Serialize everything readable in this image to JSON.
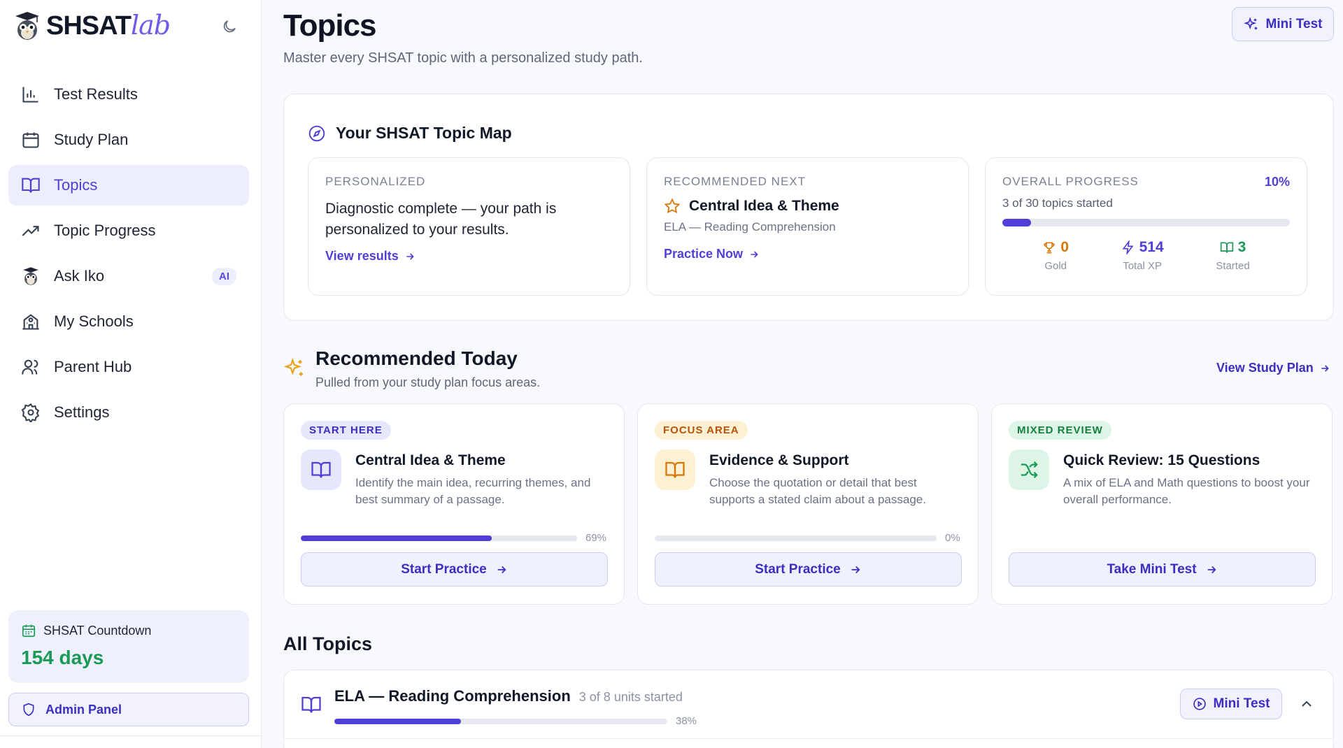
{
  "app": {
    "logo_main": "SHSAT",
    "logo_accent": "lab"
  },
  "sidebar": {
    "items": [
      {
        "label": "Test Results",
        "icon": "bar-chart-icon"
      },
      {
        "label": "Study Plan",
        "icon": "calendar-icon"
      },
      {
        "label": "Topics",
        "icon": "book-open-icon",
        "active": true
      },
      {
        "label": "Topic Progress",
        "icon": "trending-up-icon"
      },
      {
        "label": "Ask Iko",
        "icon": "owl-icon",
        "badge": "AI"
      },
      {
        "label": "My Schools",
        "icon": "school-icon"
      },
      {
        "label": "Parent Hub",
        "icon": "users-icon"
      },
      {
        "label": "Settings",
        "icon": "gear-icon"
      }
    ],
    "countdown": {
      "label": "SHSAT Countdown",
      "value": "154 days"
    },
    "admin_label": "Admin Panel"
  },
  "header": {
    "title": "Topics",
    "subtitle": "Master every SHSAT topic with a personalized study path.",
    "mini_test_label": "Mini Test"
  },
  "topic_map": {
    "title": "Your SHSAT Topic Map",
    "personalized": {
      "label": "PERSONALIZED",
      "text": "Diagnostic complete — your path is personalized to your results.",
      "link": "View results"
    },
    "recommended_next": {
      "label": "RECOMMENDED NEXT",
      "title": "Central Idea & Theme",
      "subtitle": "ELA — Reading Comprehension",
      "link": "Practice Now"
    },
    "overall": {
      "label": "OVERALL PROGRESS",
      "percent_text": "10%",
      "progress": 0.1,
      "count_text": "3 of 30 topics started",
      "stats": [
        {
          "value": "0",
          "label": "Gold",
          "color": "#d97706",
          "icon": "trophy-icon"
        },
        {
          "value": "514",
          "label": "Total XP",
          "color": "#4f3fd6",
          "icon": "lightning-icon"
        },
        {
          "value": "3",
          "label": "Started",
          "color": "#1a9a57",
          "icon": "book-icon"
        }
      ]
    }
  },
  "recommended_today": {
    "title": "Recommended Today",
    "subtitle": "Pulled from your study plan focus areas.",
    "view_plan": "View Study Plan",
    "cards": [
      {
        "pill": "START HERE",
        "pill_bg": "#e5e7fd",
        "pill_color": "#3b2ec0",
        "icon": "book-open-icon",
        "icon_bg": "#e5e7fd",
        "icon_color": "#4f3fd6",
        "title": "Central Idea & Theme",
        "desc": "Identify the main idea, recurring themes, and best summary of a passage.",
        "progress": 0.69,
        "percent_text": "69%",
        "button": "Start Practice"
      },
      {
        "pill": "FOCUS AREA",
        "pill_bg": "#fdf0d3",
        "pill_color": "#b45309",
        "icon": "book-open-icon",
        "icon_bg": "#fdf0d3",
        "icon_color": "#d97706",
        "title": "Evidence & Support",
        "desc": "Choose the quotation or detail that best supports a stated claim about a passage.",
        "progress": 0,
        "percent_text": "0%",
        "button": "Start Practice"
      },
      {
        "pill": "MIXED REVIEW",
        "pill_bg": "#dcf5e6",
        "pill_color": "#15803d",
        "icon": "shuffle-icon",
        "icon_bg": "#dcf5e6",
        "icon_color": "#1a9a57",
        "title": "Quick Review: 15 Questions",
        "desc": "A mix of ELA and Math questions to boost your overall performance.",
        "button": "Take Mini Test"
      }
    ]
  },
  "all_topics": {
    "title": "All Topics",
    "groups": [
      {
        "name": "ELA — Reading Comprehension",
        "meta": "3 of 8 units started",
        "progress": 0.38,
        "percent_text": "38%",
        "mini_test_label": "Mini Test"
      }
    ]
  },
  "colors": {
    "accent": "#4f3fd6",
    "success": "#1a9a57",
    "warning": "#d97706"
  }
}
